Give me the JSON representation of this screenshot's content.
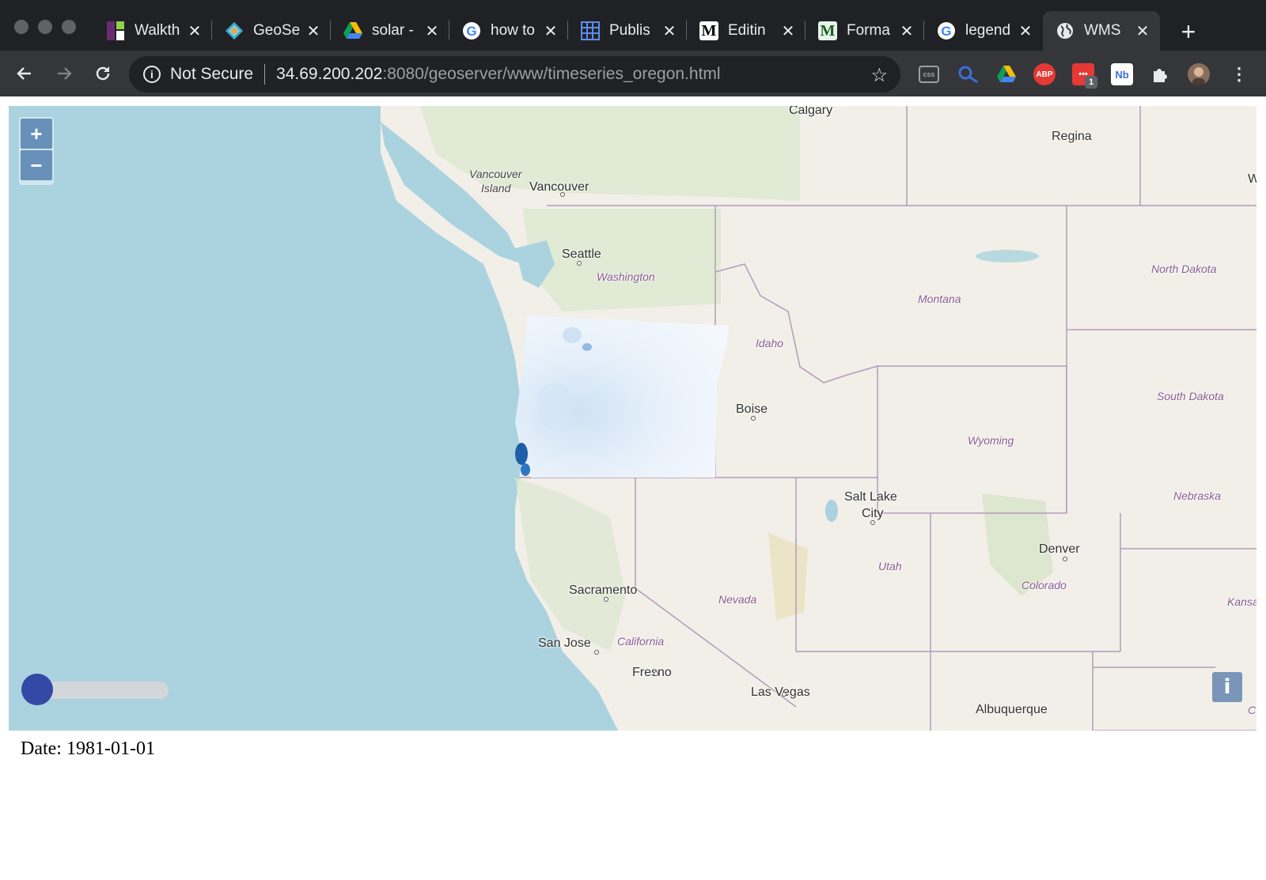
{
  "browser": {
    "tabs": [
      {
        "title": "Walkth",
        "icon": "walkthrough-favicon-icon"
      },
      {
        "title": "GeoSe",
        "icon": "geoserver-favicon-icon"
      },
      {
        "title": "solar -",
        "icon": "google-drive-favicon-icon"
      },
      {
        "title": "how to",
        "icon": "google-favicon-icon"
      },
      {
        "title": "Publis",
        "icon": "grid-favicon-icon"
      },
      {
        "title": "Editin",
        "icon": "medium-favicon-icon"
      },
      {
        "title": "Forma",
        "icon": "medium-favicon-icon"
      },
      {
        "title": "legend",
        "icon": "google-favicon-icon"
      },
      {
        "title": "WMS",
        "icon": "globe-favicon-icon",
        "active": true
      }
    ],
    "address": {
      "security_label": "Not Secure",
      "host": "34.69.200.202",
      "path": ":8080/geoserver/www/timeseries_oregon.html"
    },
    "extensions": {
      "badge_count": "1",
      "abp_label": "ABP",
      "css_label": "css"
    }
  },
  "map": {
    "zoom_in": "+",
    "zoom_out": "−",
    "attribution_button": "i",
    "slider": {
      "position_fraction": 0
    },
    "labels": {
      "cities": [
        "Calgary",
        "Regina",
        "Vancouver",
        "Seattle",
        "Boise",
        "Salt Lake",
        "City",
        "Denver",
        "Sacramento",
        "San Jose",
        "Fresno",
        "Las Vegas",
        "Albuquerque"
      ],
      "island": [
        "Vancouver",
        "Island"
      ],
      "states": [
        "Washington",
        "Montana",
        "Idaho",
        "North Dakota",
        "South Dakota",
        "Wyoming",
        "Nebraska",
        "Utah",
        "Colorado",
        "Nevada",
        "California",
        "Kansa"
      ],
      "edge_fragments": [
        "W",
        "C"
      ]
    }
  },
  "footer": {
    "date_label": "Date: 1981-01-01"
  }
}
